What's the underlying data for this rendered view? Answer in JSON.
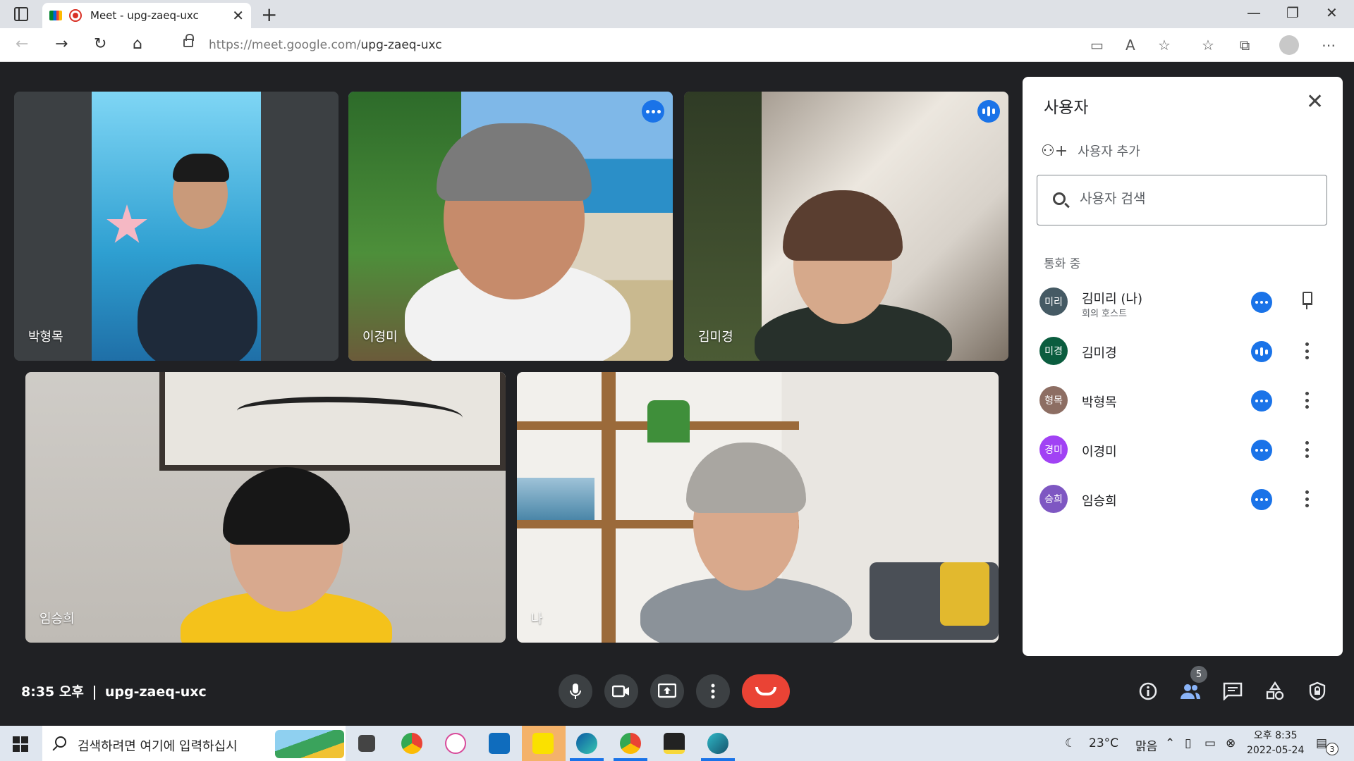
{
  "browser": {
    "tab_title": "Meet - upg-zaeq-uxc",
    "url_host": "https://meet.google.com/",
    "url_path": "upg-zaeq-uxc"
  },
  "tiles": [
    {
      "name": "박형목"
    },
    {
      "name": "이경미"
    },
    {
      "name": "김미경"
    },
    {
      "name": "임승희"
    },
    {
      "name": "나"
    }
  ],
  "panel": {
    "title": "사용자",
    "add_label": "사용자 추가",
    "search_placeholder": "사용자 검색",
    "section": "통화 중",
    "people": [
      {
        "initials": "미리",
        "name": "김미리 (나)",
        "role": "회의 호스트",
        "color": "#455a64"
      },
      {
        "initials": "미경",
        "name": "김미경",
        "color": "#0b5d3f"
      },
      {
        "initials": "형목",
        "name": "박형목",
        "color": "#8d6e63"
      },
      {
        "initials": "경미",
        "name": "이경미",
        "color": "#a142f4"
      },
      {
        "initials": "승희",
        "name": "임승희",
        "color": "#7e57c2"
      }
    ]
  },
  "controls": {
    "time": "8:35 오후",
    "meeting_code": "upg-zaeq-uxc",
    "participant_count": "5"
  },
  "taskbar": {
    "search_text": "검색하려면 여기에 입력하십시",
    "temperature": "23°C",
    "weather": "맑음",
    "time": "오후 8:35",
    "date": "2022-05-24",
    "notification_count": "3"
  },
  "colors": {
    "accent": "#1a73e8",
    "end_call": "#ea4335",
    "background": "#202124"
  }
}
